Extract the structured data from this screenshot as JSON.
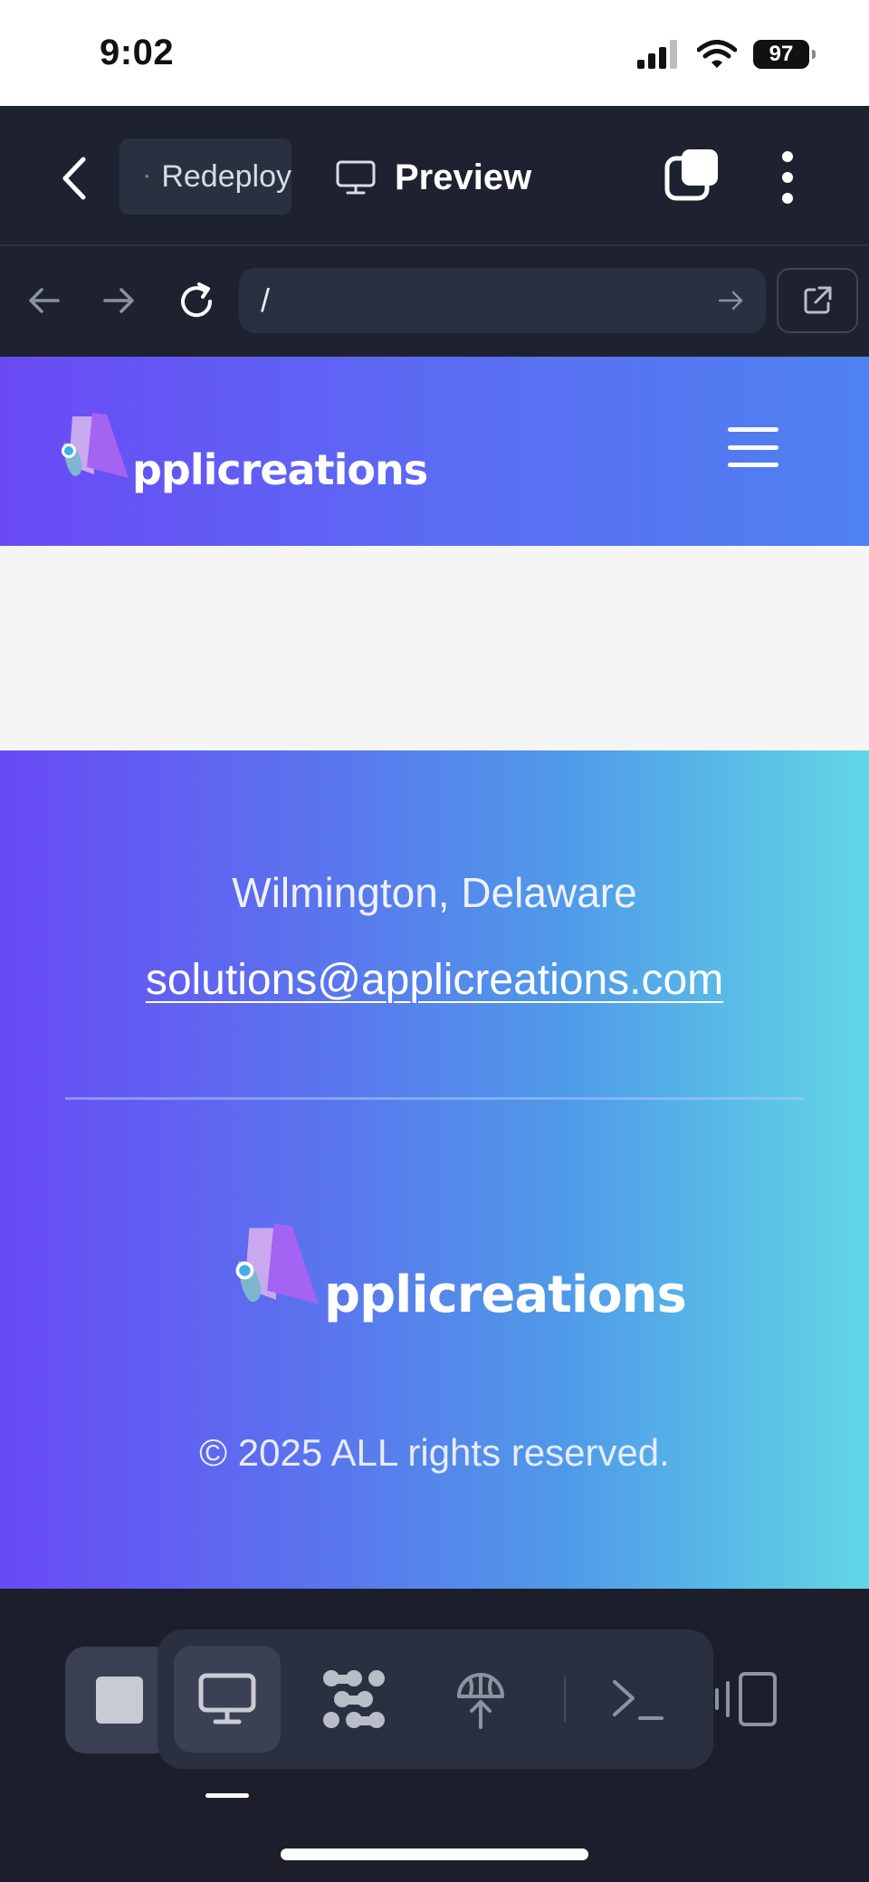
{
  "status_bar": {
    "time": "9:02",
    "battery": "97",
    "icons": [
      "cellular-signal-icon",
      "wifi-icon",
      "battery-icon"
    ]
  },
  "toolbar": {
    "back_icon": "chevron-left-icon",
    "tab_redeploy": {
      "label": "Redeploy",
      "icon": "antenna-icon"
    },
    "tab_preview": {
      "label": "Preview",
      "icon": "monitor-icon"
    },
    "copy_icon": "copy-icon",
    "more_icon": "more-vertical-icon"
  },
  "url_bar": {
    "value": "/",
    "icons": [
      "arrow-left-icon",
      "arrow-right-icon",
      "reload-icon",
      "arrow-right-icon",
      "external-link-icon"
    ]
  },
  "site": {
    "logo_text": "pplicreations",
    "menu_icon": "hamburger-menu-icon",
    "footer": {
      "address": "Wilmington, Delaware",
      "email": "solutions@applicreations.com",
      "copyright": "© 2025 ALL rights reserved."
    }
  },
  "dock": {
    "items": [
      "stop-icon",
      "monitor-icon",
      "integrations-icon",
      "deploy-icon",
      "terminal-icon",
      "devices-icon"
    ],
    "active": "monitor-icon"
  },
  "colors": {
    "header_gradient": [
      "#6a4af5",
      "#4f82f0"
    ],
    "footer_gradient": [
      "#684af5",
      "#62d7e6"
    ],
    "app_dark": "#1e2230"
  }
}
